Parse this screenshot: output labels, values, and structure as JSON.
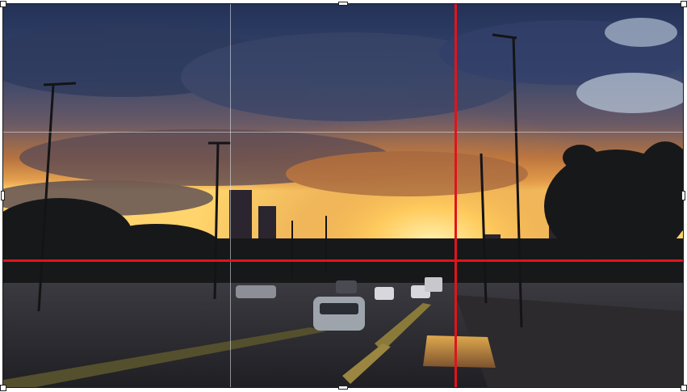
{
  "editor": {
    "mode": "crop",
    "grid": "rule-of-thirds",
    "guide_color": "#e0141c",
    "grid_color": "#e6ebf0"
  },
  "photo": {
    "subject": "sunset-over-city-highway",
    "sky_colors": [
      "#2c3b62",
      "#c27a3e",
      "#ffd26a"
    ],
    "ground_color": "#2a2b30"
  },
  "icons": {
    "corner_handle": "square-handle-icon",
    "edge_handle": "bar-handle-icon"
  }
}
